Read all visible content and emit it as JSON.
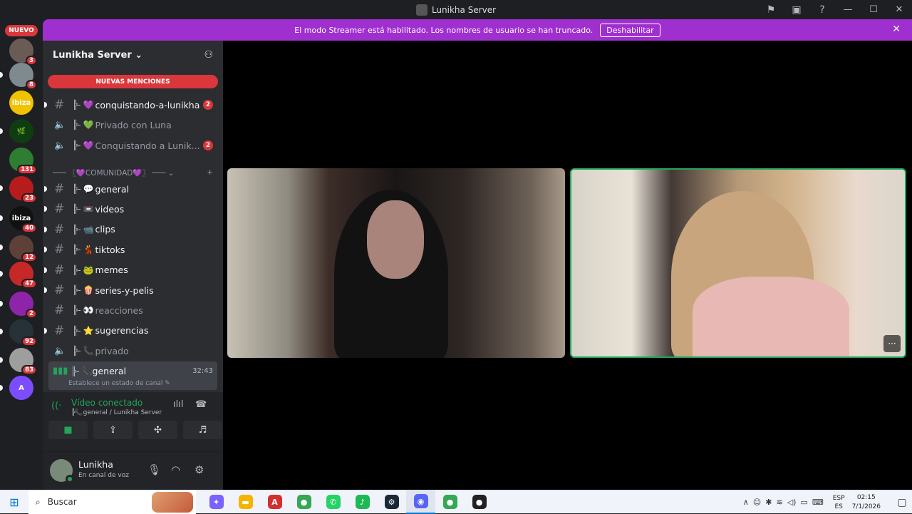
{
  "window": {
    "title": "Lunikha Server",
    "tools": [
      "flag-icon",
      "inbox-icon",
      "help-icon"
    ],
    "controls": [
      "—",
      "☐",
      "✕"
    ]
  },
  "rail": {
    "new_label": "NUEVO",
    "servers": [
      {
        "icon": "server-a",
        "badge": "3",
        "color": "#6b5b55",
        "text": ""
      },
      {
        "icon": "server-b",
        "badge": "8",
        "color": "#7f8a8e",
        "text": ""
      },
      {
        "icon": "ibiza-icon",
        "badge": "",
        "color": "#f2c200",
        "text": "ibiza"
      },
      {
        "icon": "leaf-icon",
        "badge": "",
        "color": "#0f3d12",
        "text": "🌿"
      },
      {
        "icon": "server-c",
        "badge": "131",
        "color": "#2e7d32",
        "text": ""
      },
      {
        "icon": "lips-icon",
        "badge": "23",
        "color": "#b71c1c",
        "text": ""
      },
      {
        "icon": "ibiza-dark-icon",
        "badge": "40",
        "color": "#111111",
        "text": "ibiza"
      },
      {
        "icon": "server-d",
        "badge": "12",
        "color": "#5d4037",
        "text": ""
      },
      {
        "icon": "server-e",
        "badge": "47",
        "color": "#c62828",
        "text": ""
      },
      {
        "icon": "server-f",
        "badge": "2",
        "color": "#8e24aa",
        "text": ""
      },
      {
        "icon": "imperium-icon",
        "badge": "92",
        "color": "#263238",
        "text": ""
      },
      {
        "icon": "server-g",
        "badge": "83",
        "color": "#9e9e9e",
        "text": ""
      },
      {
        "icon": "server-h",
        "badge": "",
        "color": "#7c4dff",
        "text": "A"
      }
    ]
  },
  "banner": {
    "message": "El modo Streamer está habilitado. Los nombres de usuario se han truncado.",
    "button_label": "Deshabilitar"
  },
  "sidebar": {
    "server_name": "Lunikha Server ⌄",
    "mentions_label": "NUEVAS MENCIONES",
    "channels_top": [
      {
        "type": "text",
        "tree": "╠-",
        "emoji": "💜",
        "name": "conquistando-a-lunikha",
        "count": "2",
        "muted": false
      },
      {
        "type": "voice",
        "tree": "╠-",
        "emoji": "💚",
        "name": "Privado con Luna",
        "count": "",
        "muted": true
      },
      {
        "type": "voice",
        "tree": "╠-",
        "emoji": "💜",
        "name": " Conquistando a Lunik...",
        "count": "2",
        "muted": true
      }
    ],
    "category": "─── 〖💜COMUNIDAD💜〗 ───  ⌄",
    "category_add": "+",
    "channels": [
      {
        "type": "text",
        "tree": "╠-",
        "emoji": "💬",
        "name": "general",
        "muted": false
      },
      {
        "type": "text",
        "tree": "╠-",
        "emoji": "📼",
        "name": "videos",
        "muted": false
      },
      {
        "type": "text",
        "tree": "╠-",
        "emoji": "📹",
        "name": "clips",
        "muted": false
      },
      {
        "type": "text",
        "tree": "╠-",
        "emoji": "💃",
        "name": "tiktoks",
        "muted": false
      },
      {
        "type": "text",
        "tree": "╠-",
        "emoji": "🐸",
        "name": "memes",
        "muted": false
      },
      {
        "type": "text",
        "tree": "╠-",
        "emoji": "🍿",
        "name": "series-y-pelis",
        "muted": false
      },
      {
        "type": "text",
        "tree": "╠-",
        "emoji": "👀",
        "name": "reacciones",
        "muted": true
      },
      {
        "type": "text",
        "tree": "╠-",
        "emoji": "⭐",
        "name": "sugerencias",
        "muted": false
      },
      {
        "type": "voice",
        "tree": "╠-",
        "emoji": "📞",
        "name": "privado",
        "muted": true
      }
    ],
    "active_voice": {
      "tree": "╠-",
      "emoji": "📞",
      "name": "general",
      "timer": "32:43",
      "status": "Establece un estado de canal ✎"
    }
  },
  "voice_panel": {
    "status": "Vídeo conectado",
    "location": "╠📞general / Lunikha Server",
    "buttons": [
      {
        "icon": "camera-icon",
        "glyph": "■"
      },
      {
        "icon": "screen-share-icon",
        "glyph": "⇪"
      },
      {
        "icon": "activities-icon",
        "glyph": "✣"
      },
      {
        "icon": "soundboard-icon",
        "glyph": "♬"
      }
    ]
  },
  "user": {
    "name": "Lunikha",
    "status": "En canal de voz"
  },
  "videos": {
    "more_label": "···"
  },
  "taskbar": {
    "search_placeholder": "Buscar",
    "apps": [
      {
        "icon": "copilot-icon",
        "label": "✦",
        "color": "#7b61ff"
      },
      {
        "icon": "file-explorer-icon",
        "label": "▬",
        "color": "#f4b400"
      },
      {
        "icon": "acrobat-icon",
        "label": "A",
        "color": "#d32f2f"
      },
      {
        "icon": "chrome-icon",
        "label": "●",
        "color": "#34a853"
      },
      {
        "icon": "whatsapp-icon",
        "label": "✆",
        "color": "#25d366"
      },
      {
        "icon": "spotify-icon",
        "label": "♪",
        "color": "#1db954"
      },
      {
        "icon": "steam-icon",
        "label": "⚙",
        "color": "#1b2838"
      },
      {
        "icon": "discord-icon",
        "label": "◉",
        "color": "#5865f2"
      },
      {
        "icon": "chrome-profile-icon",
        "label": "●",
        "color": "#34a853"
      },
      {
        "icon": "app-icon",
        "label": "●",
        "color": "#222222"
      }
    ],
    "lang_top": "ESP",
    "lang_bottom": "ES",
    "time": "02:15",
    "date": "7/1/2026"
  }
}
